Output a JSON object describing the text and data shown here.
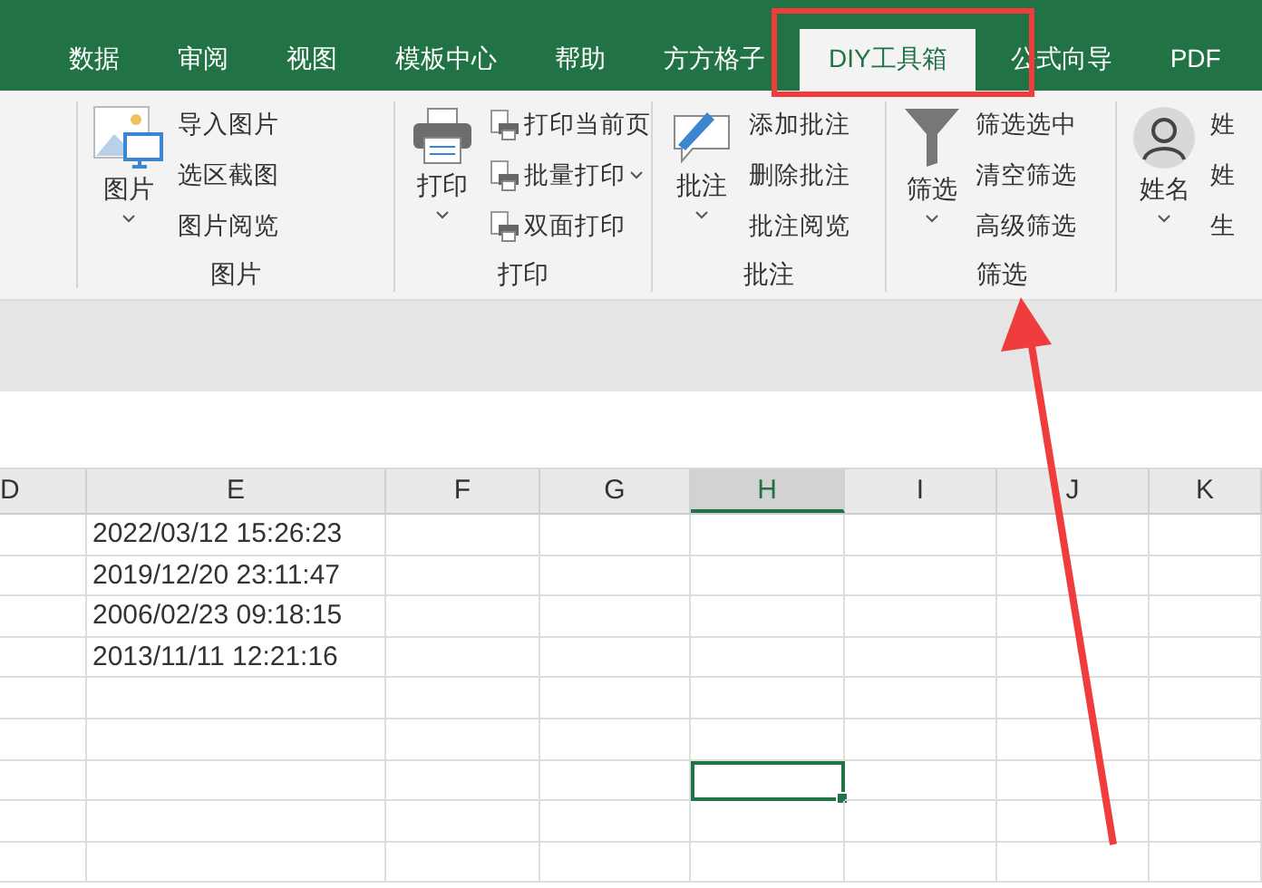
{
  "tabs": [
    {
      "label": "数据",
      "selected": false
    },
    {
      "label": "审阅",
      "selected": false
    },
    {
      "label": "视图",
      "selected": false
    },
    {
      "label": "模板中心",
      "selected": false
    },
    {
      "label": "帮助",
      "selected": false
    },
    {
      "label": "方方格子",
      "selected": false
    },
    {
      "label": "DIY工具箱",
      "selected": true
    },
    {
      "label": "公式向导",
      "selected": false
    },
    {
      "label": "PDF",
      "selected": false
    }
  ],
  "ribbon_groups": [
    {
      "kind": "picture",
      "label": "图片",
      "button": "图片",
      "items": [
        {
          "label": "导入图片",
          "dropdown": false
        },
        {
          "label": "选区截图",
          "dropdown": false
        },
        {
          "label": "图片阅览",
          "dropdown": false
        }
      ]
    },
    {
      "kind": "print",
      "label": "打印",
      "button": "打印",
      "items": [
        {
          "label": "打印当前页",
          "dropdown": false
        },
        {
          "label": "批量打印",
          "dropdown": true
        },
        {
          "label": "双面打印",
          "dropdown": false
        }
      ]
    },
    {
      "kind": "comment",
      "label": "批注",
      "button": "批注",
      "items": [
        {
          "label": "添加批注",
          "dropdown": false
        },
        {
          "label": "删除批注",
          "dropdown": false
        },
        {
          "label": "批注阅览",
          "dropdown": false
        }
      ]
    },
    {
      "kind": "filter",
      "label": "筛选",
      "button": "筛选",
      "items": [
        {
          "label": "筛选选中",
          "dropdown": false
        },
        {
          "label": "清空筛选",
          "dropdown": false
        },
        {
          "label": "高级筛选",
          "dropdown": false
        }
      ]
    },
    {
      "kind": "person",
      "button": "姓名",
      "items": [
        {
          "label": "姓",
          "dropdown": false
        },
        {
          "label": "姓",
          "dropdown": false
        },
        {
          "label": "生",
          "dropdown": false
        }
      ]
    }
  ],
  "sheet": {
    "columns": [
      {
        "label": "D",
        "selected": false
      },
      {
        "label": "E",
        "selected": false
      },
      {
        "label": "F",
        "selected": false
      },
      {
        "label": "G",
        "selected": false
      },
      {
        "label": "H",
        "selected": true
      },
      {
        "label": "I",
        "selected": false
      },
      {
        "label": "J",
        "selected": false
      },
      {
        "label": "K",
        "selected": false
      }
    ],
    "rows": [
      {
        "selected": false,
        "column_e": "2022/03/12 15:26:23"
      },
      {
        "selected": false,
        "column_e": "2019/12/20 23:11:47"
      },
      {
        "selected": false,
        "column_e": "2006/02/23 09:18:15"
      },
      {
        "selected": false,
        "column_e": "2013/11/11 12:21:16"
      },
      {
        "selected": false
      },
      {
        "selected": false
      },
      {
        "selected": true
      },
      {
        "selected": false
      },
      {
        "selected": false
      }
    ]
  }
}
